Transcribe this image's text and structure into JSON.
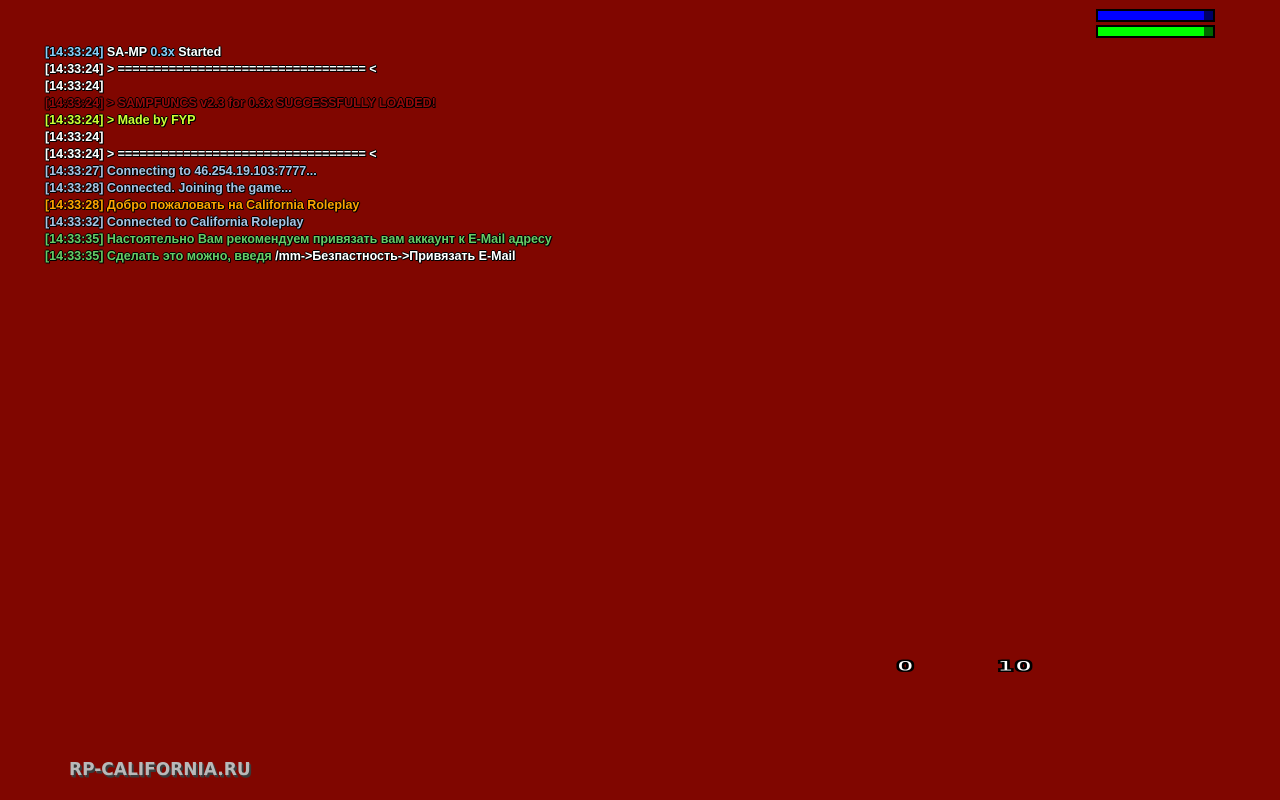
{
  "hud": {
    "armor_bar": {
      "fraction": 0.92,
      "fill_color": "#0000ff",
      "empty_color": "#000066"
    },
    "health_bar": {
      "fraction": 0.92,
      "fill_color": "#00ff00",
      "empty_color": "#006600"
    }
  },
  "chat": {
    "lines": [
      {
        "time": "[14:33:24]",
        "time_color": "#87cefa",
        "segments": [
          {
            "text": " SA-MP ",
            "color": "#ffffff"
          },
          {
            "text": "0.3x",
            "color": "#87cefa"
          },
          {
            "text": " Started",
            "color": "#ffffff"
          }
        ]
      },
      {
        "time": "[14:33:24]",
        "time_color": "#ffffff",
        "segments": [
          {
            "text": " > ================================== <",
            "color": "#ffffff"
          }
        ]
      },
      {
        "time": "[14:33:24]",
        "time_color": "#ffffff",
        "segments": []
      },
      {
        "time": "[14:33:24]",
        "time_color": "#9a0a0a",
        "segments": [
          {
            "text": " > SAMPFUNCS v2.3 for 0.3x SUCCESSFULLY LOADED!",
            "color": "#9a0a0a"
          }
        ]
      },
      {
        "time": "[14:33:24]",
        "time_color": "#ccff33",
        "segments": [
          {
            "text": " > Made by FYP",
            "color": "#ccff33"
          }
        ]
      },
      {
        "time": "[14:33:24]",
        "time_color": "#ffffff",
        "segments": []
      },
      {
        "time": "[14:33:24]",
        "time_color": "#ffffff",
        "segments": [
          {
            "text": " > ================================== <",
            "color": "#ffffff"
          }
        ]
      },
      {
        "time": "[14:33:27]",
        "time_color": "#a9c4e4",
        "segments": [
          {
            "text": " Connecting to 46.254.19.103:7777...",
            "color": "#a9c4e4"
          }
        ]
      },
      {
        "time": "[14:33:28]",
        "time_color": "#a9c4e4",
        "segments": [
          {
            "text": " Connected. Joining the game...",
            "color": "#a9c4e4"
          }
        ]
      },
      {
        "time": "[14:33:28]",
        "time_color": "#ffa500",
        "segments": [
          {
            "text": " Добро пожаловать на California Roleplay",
            "color": "#ffa500"
          }
        ]
      },
      {
        "time": "[14:33:32]",
        "time_color": "#a9c4e4",
        "segments": [
          {
            "text": " Connected to California Roleplay",
            "color": "#a9c4e4"
          }
        ]
      },
      {
        "time": "[14:33:35]",
        "time_color": "#66cc66",
        "segments": [
          {
            "text": " Настоятельно Вам рекомендуем привязать вам аккаунт к E-Mail адресу",
            "color": "#66cc66"
          }
        ]
      },
      {
        "time": "[14:33:35]",
        "time_color": "#66cc66",
        "segments": [
          {
            "text": " Сделать это можно, введя ",
            "color": "#66cc66"
          },
          {
            "text": "/mm->Безпастность->Привязать E-Mail",
            "color": "#ffffff"
          }
        ]
      }
    ]
  },
  "ammo": {
    "clip": "0",
    "total": "10"
  },
  "logo": {
    "text": "RP-CALIFORNIA.RU"
  }
}
